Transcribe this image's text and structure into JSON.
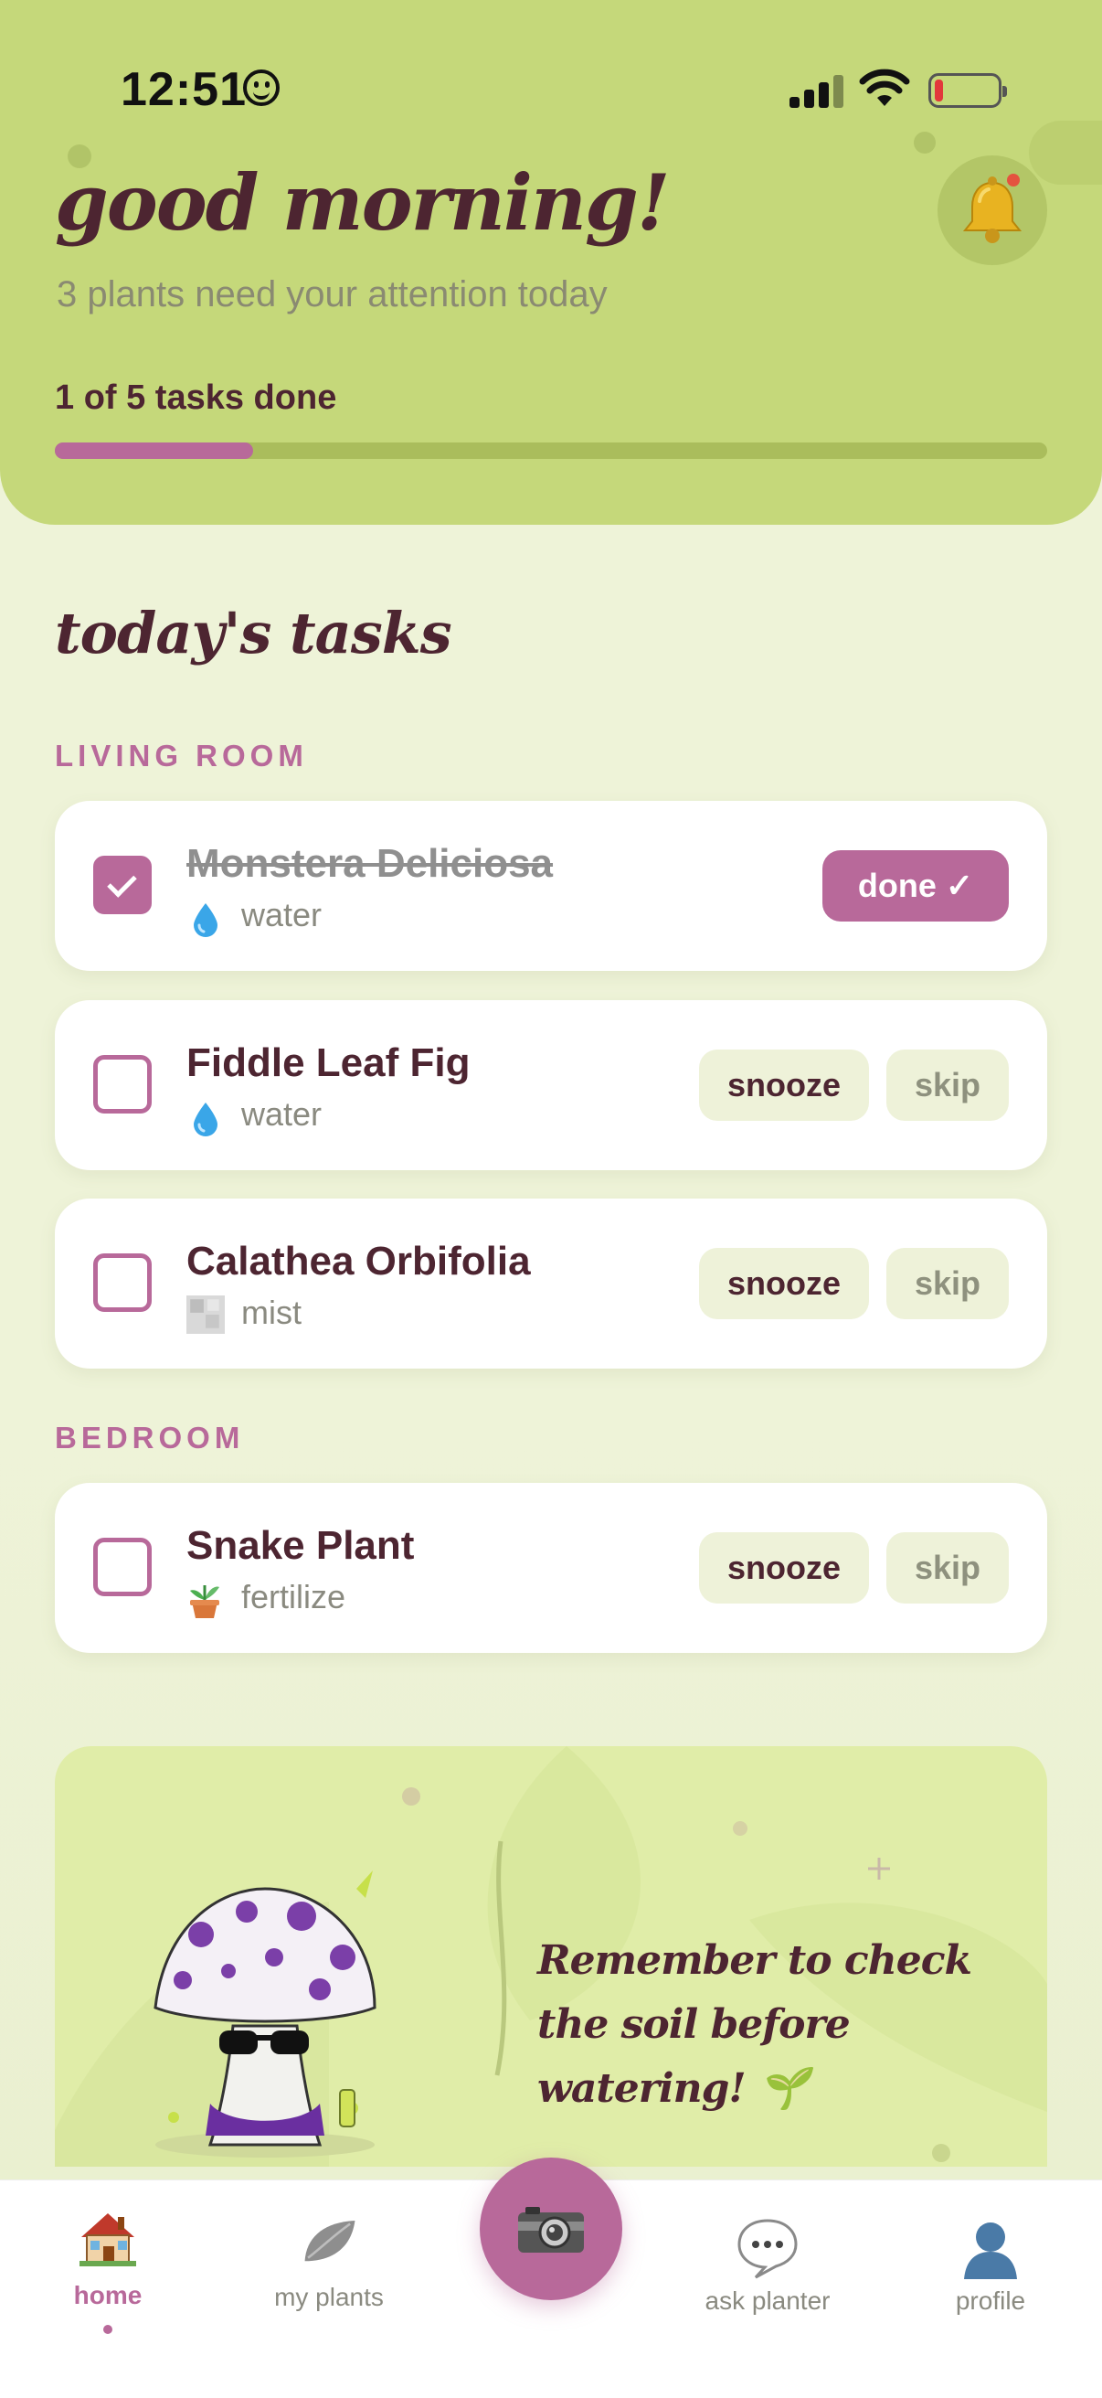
{
  "status_bar": {
    "time": "12:51"
  },
  "header": {
    "greeting": "good morning!",
    "subtitle": "3 plants need your attention today",
    "progress_label": "1 of 5 tasks done",
    "progress_fraction": 0.2,
    "notification_icon": "bell-icon"
  },
  "section_title": "today's tasks",
  "rooms": [
    {
      "label": "LIVING ROOM",
      "tasks": [
        {
          "plant": "Monstera Deliciosa",
          "action": "water",
          "icon": "water-drop-icon",
          "checked": true,
          "button": "done ✓"
        },
        {
          "plant": "Fiddle Leaf Fig",
          "action": "water",
          "icon": "water-drop-icon",
          "checked": false,
          "snooze": "snooze",
          "skip": "skip"
        },
        {
          "plant": "Calathea Orbifolia",
          "action": "mist",
          "icon": "mist-icon",
          "checked": false,
          "snooze": "snooze",
          "skip": "skip"
        }
      ]
    },
    {
      "label": "BEDROOM",
      "tasks": [
        {
          "plant": "Snake Plant",
          "action": "fertilize",
          "icon": "potted-plant-icon",
          "checked": false,
          "snooze": "snooze",
          "skip": "skip"
        }
      ]
    }
  ],
  "tip": {
    "text": "Remember to check the soil before watering! 🌱"
  },
  "nav": {
    "items": [
      {
        "label": "home",
        "icon": "house-icon",
        "active": true
      },
      {
        "label": "my plants",
        "icon": "leaf-icon",
        "active": false
      },
      {
        "label": "",
        "icon": "camera-icon",
        "active": false
      },
      {
        "label": "ask planter",
        "icon": "speech-bubble-icon",
        "active": false
      },
      {
        "label": "profile",
        "icon": "person-icon",
        "active": false
      }
    ]
  },
  "colors": {
    "accent": "#b8699a",
    "header_bg": "#c5d87a",
    "text_dark": "#4d2531",
    "page_bg": "#eef3d8"
  }
}
